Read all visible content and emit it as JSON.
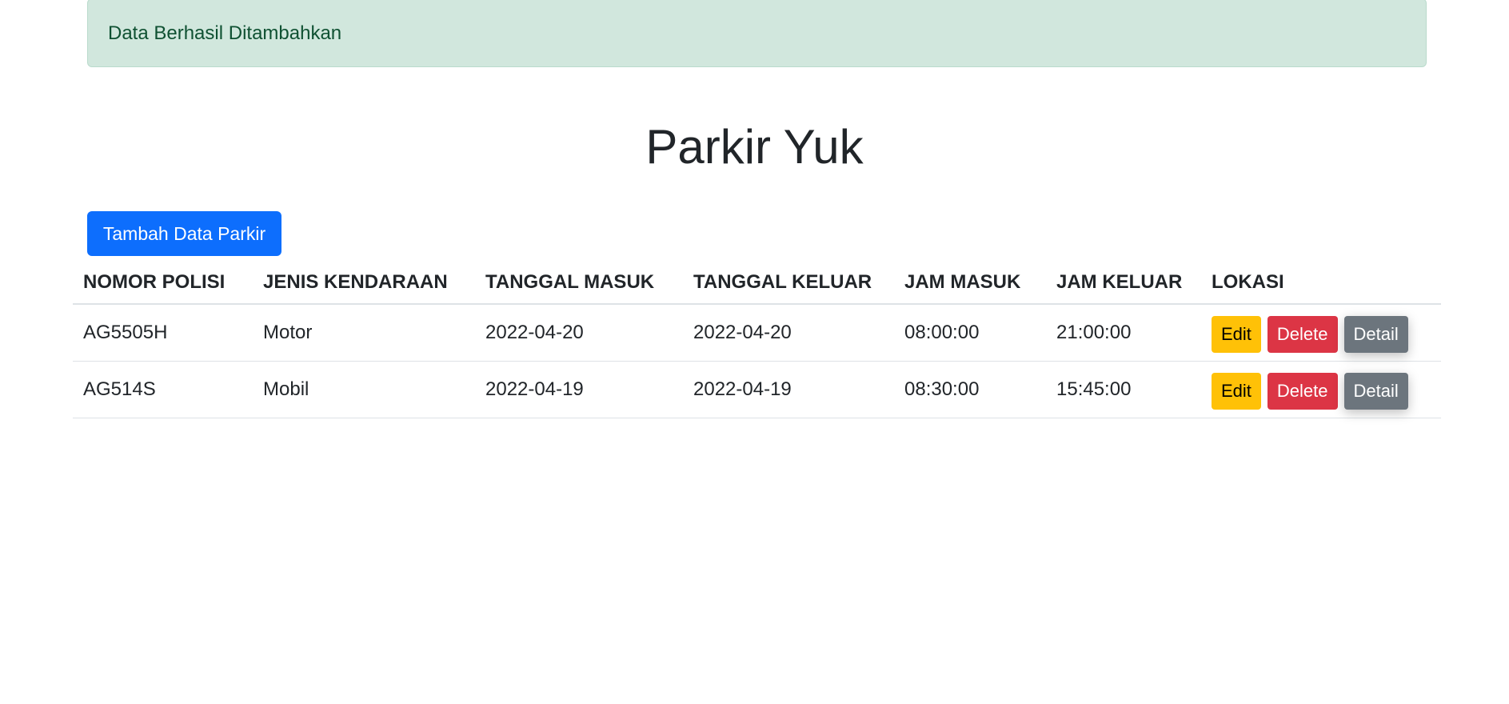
{
  "alert": {
    "message": "Data Berhasil Ditambahkan"
  },
  "page": {
    "title": "Parkir Yuk"
  },
  "toolbar": {
    "add_label": "Tambah Data Parkir"
  },
  "table": {
    "headers": [
      "NOMOR POLISI",
      "JENIS KENDARAAN",
      "TANGGAL MASUK",
      "TANGGAL KELUAR",
      "JAM MASUK",
      "JAM KELUAR",
      "LOKASI"
    ],
    "rows": [
      {
        "nomor_polisi": "AG5505H",
        "jenis_kendaraan": "Motor",
        "tanggal_masuk": "2022-04-20",
        "tanggal_keluar": "2022-04-20",
        "jam_masuk": "08:00:00",
        "jam_keluar": "21:00:00"
      },
      {
        "nomor_polisi": "AG514S",
        "jenis_kendaraan": "Mobil",
        "tanggal_masuk": "2022-04-19",
        "tanggal_keluar": "2022-04-19",
        "jam_masuk": "08:30:00",
        "jam_keluar": "15:45:00"
      }
    ],
    "actions": {
      "edit": "Edit",
      "delete": "Delete",
      "detail": "Detail"
    }
  },
  "colors": {
    "alert_bg": "#d1e7dd",
    "alert_text": "#0f5132",
    "primary": "#0d6efd",
    "warning": "#ffc107",
    "danger": "#dc3545",
    "secondary": "#6c757d"
  }
}
